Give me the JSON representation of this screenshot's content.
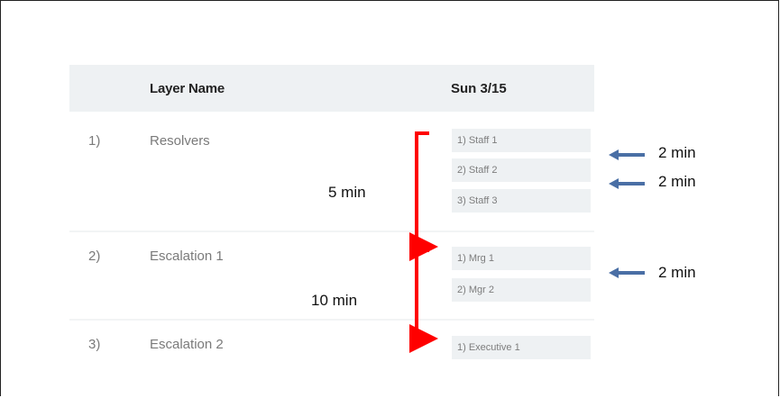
{
  "header": {
    "layer_name": "Layer Name",
    "day": "Sun 3/15"
  },
  "layers": [
    {
      "num": "1)",
      "name": "Resolvers",
      "slots": [
        "1) Staff 1",
        "2) Staff 2",
        "3) Staff 3"
      ]
    },
    {
      "num": "2)",
      "name": "Escalation 1",
      "slots": [
        "1) Mrg 1",
        "2) Mgr 2"
      ]
    },
    {
      "num": "3)",
      "name": "Escalation 2",
      "slots": [
        "1) Executive 1"
      ]
    }
  ],
  "annotations": {
    "bracket1": "5 min",
    "bracket2": "10 min",
    "arrow1": "2 min",
    "arrow2": "2 min",
    "arrow3": "2 min"
  },
  "colors": {
    "bracket": "#ff0000",
    "arrow": "#4a6fa5"
  }
}
